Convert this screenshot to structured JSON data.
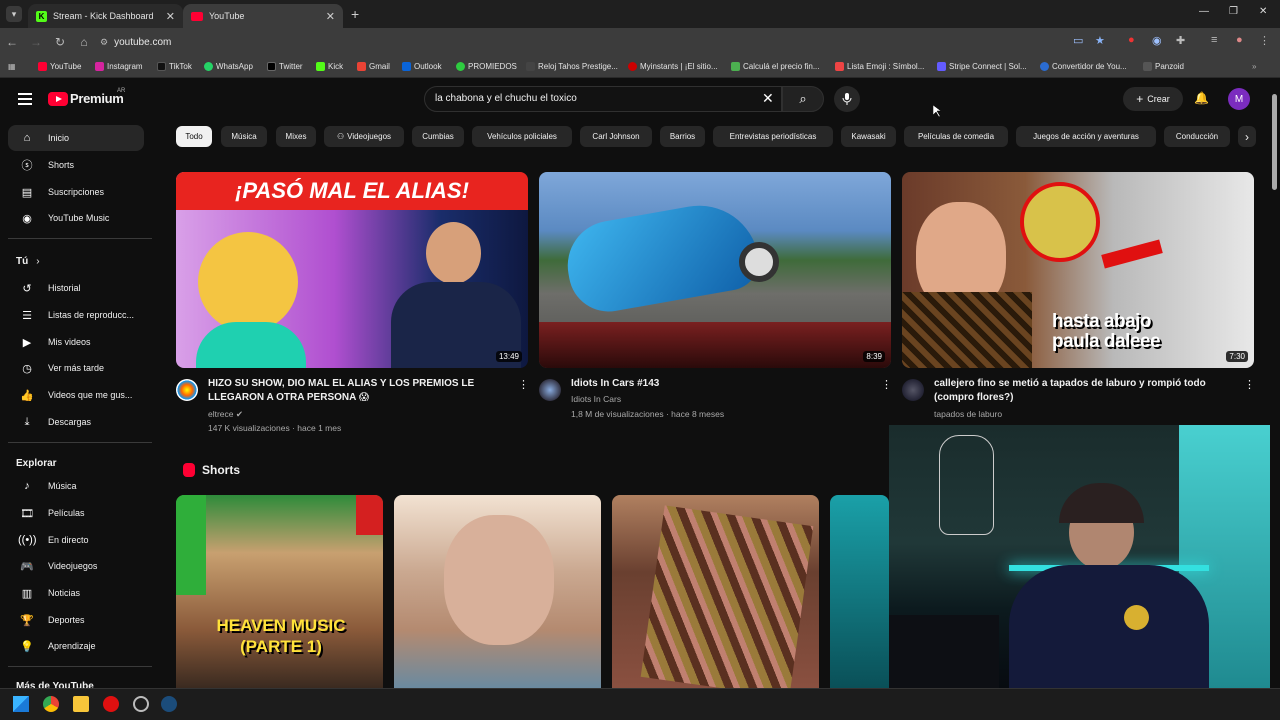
{
  "browser": {
    "tabs": [
      {
        "label": "Stream - Kick Dashboard",
        "active": false
      },
      {
        "label": "YouTube",
        "active": true
      }
    ],
    "url": "youtube.com",
    "bookmarks": [
      "YouTube",
      "Instagram",
      "TikTok",
      "WhatsApp",
      "Twitter",
      "Kick",
      "Gmail",
      "Outlook",
      "PROMIEDOS",
      "Reloj Tahos Prestige...",
      "Myinstants | ¡El sitio...",
      "Calculá el precio fin...",
      "Lista Emoji : Símbol...",
      "Stripe Connect | Sol...",
      "Convertidor de You...",
      "Panzoid"
    ]
  },
  "youtube": {
    "logo_text": "Premium",
    "country": "AR",
    "search_value": "la chabona y el chuchu el toxico",
    "create_label": "Crear",
    "avatar_letter": "M"
  },
  "sidebar": {
    "main": [
      {
        "label": "Inicio",
        "icon": "home-icon"
      },
      {
        "label": "Shorts",
        "icon": "shorts-icon"
      },
      {
        "label": "Suscripciones",
        "icon": "subscriptions-icon"
      },
      {
        "label": "YouTube Music",
        "icon": "music-icon"
      }
    ],
    "you_header": "Tú",
    "you": [
      {
        "label": "Historial",
        "icon": "history-icon"
      },
      {
        "label": "Listas de reproducc...",
        "icon": "playlist-icon"
      },
      {
        "label": "Mis videos",
        "icon": "my-videos-icon"
      },
      {
        "label": "Ver más tarde",
        "icon": "watch-later-icon"
      },
      {
        "label": "Videos que me gus...",
        "icon": "like-icon"
      },
      {
        "label": "Descargas",
        "icon": "download-icon"
      }
    ],
    "explore_header": "Explorar",
    "explore": [
      {
        "label": "Música",
        "icon": "music-note-icon"
      },
      {
        "label": "Películas",
        "icon": "movies-icon"
      },
      {
        "label": "En directo",
        "icon": "live-icon"
      },
      {
        "label": "Videojuegos",
        "icon": "gaming-icon"
      },
      {
        "label": "Noticias",
        "icon": "news-icon"
      },
      {
        "label": "Deportes",
        "icon": "sports-icon"
      },
      {
        "label": "Aprendizaje",
        "icon": "learning-icon"
      }
    ],
    "more_header": "Más de YouTube"
  },
  "chips": [
    "Todo",
    "Música",
    "Mixes",
    "Videojuegos",
    "Cumbias",
    "Vehículos policiales",
    "Carl Johnson",
    "Barrios",
    "Entrevistas periodísticas",
    "Kawasaki",
    "Películas de comedia",
    "Juegos de acción y aventuras",
    "Conducción"
  ],
  "videos": [
    {
      "thumb_text": "¡PASÓ MAL EL ALIAS!",
      "duration": "13:49",
      "title1": "HIZO SU SHOW, DIO MAL EL ALIAS Y LOS PREMIOS LE",
      "title2": "LLEGARON A OTRA PERSONA 😱",
      "channel": "eltrece",
      "stats": "147 K visualizaciones · hace 1 mes"
    },
    {
      "thumb_text": "",
      "duration": "8:39",
      "title1": "Idiots In Cars #143",
      "title2": "",
      "channel": "Idiots In Cars",
      "stats": "1,8 M de visualizaciones · hace 8 meses"
    },
    {
      "thumb_text": "hasta abajo paula daleee",
      "duration": "7:30",
      "title1": "callejero fino se metió a tapados de laburo y rompió todo",
      "title2": "(compro flores?)",
      "channel": "tapados de laburo",
      "stats": ""
    }
  ],
  "shorts_header": "Shorts",
  "shorts": [
    {
      "overlay": "HEAVEN MUSIC (PARTE 1)"
    },
    {
      "overlay": ""
    },
    {
      "overlay": ""
    }
  ]
}
